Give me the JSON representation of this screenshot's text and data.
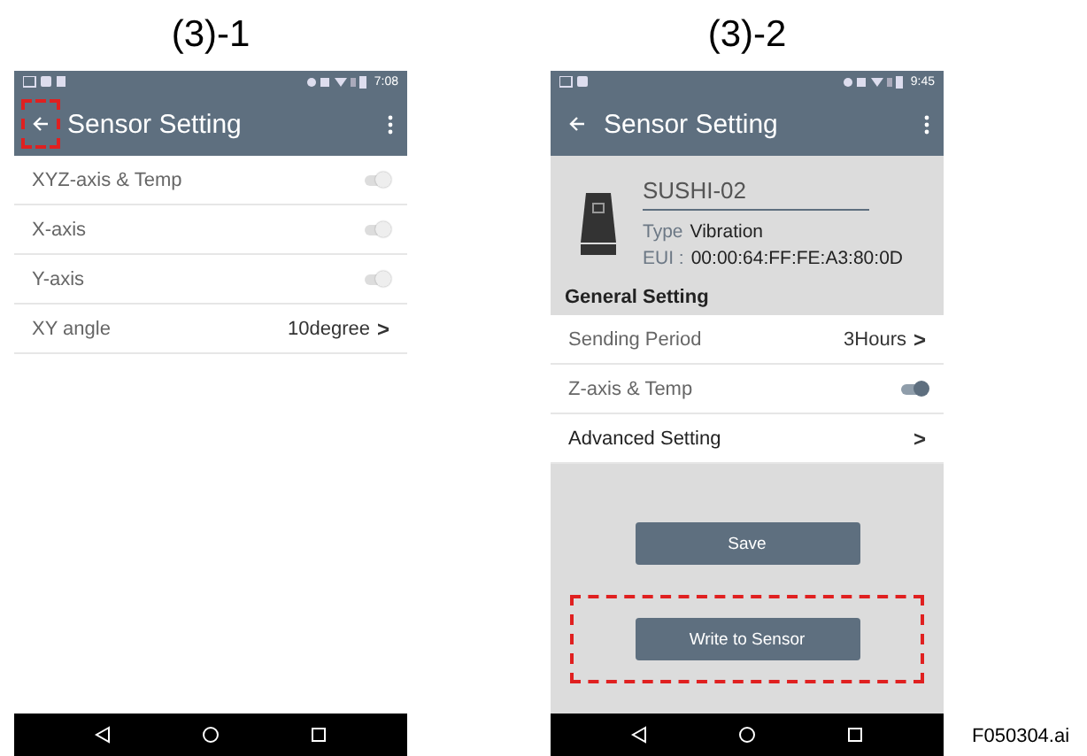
{
  "panels": [
    {
      "kind": "list",
      "caption": "(3)-1",
      "status_time": "7:08",
      "title": "Sensor Setting",
      "back_highlighted": true,
      "rows": [
        {
          "kind": "toggle",
          "label": "XYZ-axis & Temp",
          "on": false
        },
        {
          "kind": "toggle",
          "label": "X-axis",
          "on": false
        },
        {
          "kind": "toggle",
          "label": "Y-axis",
          "on": false
        },
        {
          "kind": "value",
          "label": "XY angle",
          "value": "10degree",
          "chevron": ">"
        }
      ]
    },
    {
      "kind": "device",
      "caption": "(3)-2",
      "status_time": "9:45",
      "title": "Sensor Setting",
      "back_highlighted": false,
      "device": {
        "name": "SUSHI-02",
        "type_label": "Type",
        "type_value": "Vibration",
        "eui_label": "EUI :",
        "eui_value": "00:00:64:FF:FE:A3:80:0D"
      },
      "section": "General Setting",
      "rows": [
        {
          "kind": "value",
          "label": "Sending Period",
          "value": "3Hours",
          "chevron": ">"
        },
        {
          "kind": "toggle",
          "label": "Z-axis & Temp",
          "on": true
        },
        {
          "kind": "link",
          "label": "Advanced Setting",
          "chevron": ">"
        }
      ],
      "buttons": [
        {
          "label": "Save",
          "highlighted": false
        },
        {
          "label": "Write to Sensor",
          "highlighted": true
        }
      ]
    }
  ],
  "figure_id": "F050304.ai"
}
